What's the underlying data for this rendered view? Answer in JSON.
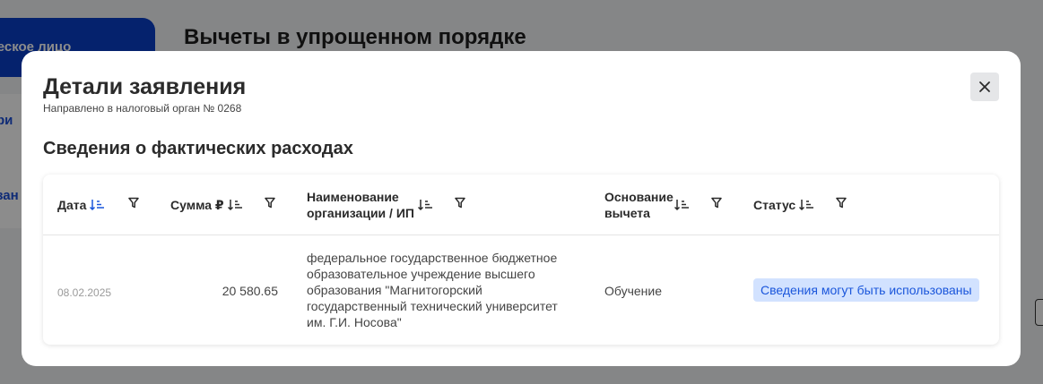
{
  "background": {
    "side_tab_label": "ческое лицо",
    "page_title": "Вычеты в упрощенном порядке",
    "side_link_1": "ри",
    "side_link_2": "зан"
  },
  "modal": {
    "title": "Детали заявления",
    "subtitle": "Направлено в налоговый орган № 0268",
    "close_icon": "close-icon",
    "section_title": "Сведения о фактических расходах"
  },
  "table": {
    "columns": [
      {
        "label": "Дата",
        "sort_active": true
      },
      {
        "label": "Сумма ₽",
        "sort_active": false
      },
      {
        "label": "Наименование организации / ИП",
        "sort_active": false
      },
      {
        "label": "Основание вычета",
        "sort_active": false
      },
      {
        "label": "Статус",
        "sort_active": false
      }
    ],
    "rows": [
      {
        "date": "08.02.2025",
        "sum": "20 580.65",
        "org": "федеральное государственное бюджетное образовательное учреждение высшего образования \"Магнитогорский государственный технический университет им. Г.И. Носова\"",
        "basis": "Обучение",
        "status": "Сведения могут быть использованы"
      }
    ]
  },
  "colors": {
    "accent": "#1a56db",
    "status_bg": "#d2e2ff",
    "primary_tab": "#0a3ec7"
  }
}
